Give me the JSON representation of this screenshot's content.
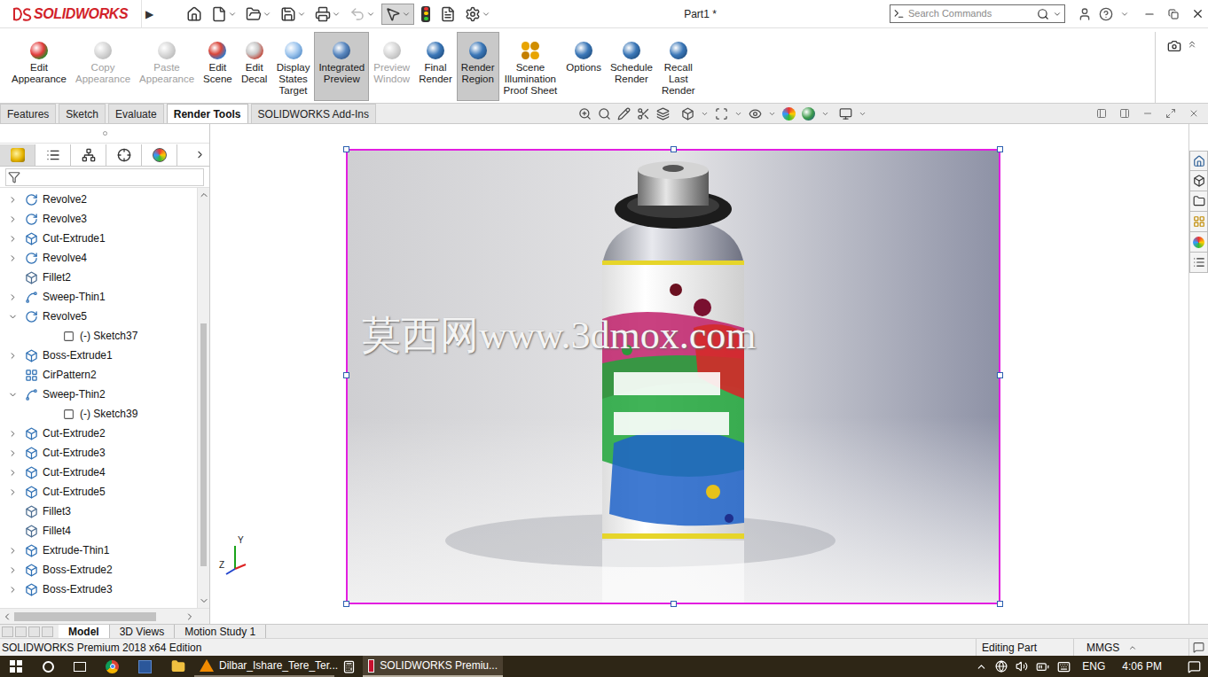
{
  "title_bar": {
    "logo": "SOLIDWORKS",
    "expand": "▶",
    "document": "Part1 *",
    "search": {
      "placeholder": "Search Commands"
    }
  },
  "quick_access": [
    {
      "kind": "home",
      "disabled": false,
      "selected": false
    },
    {
      "kind": "new",
      "disabled": false,
      "selected": false
    },
    {
      "kind": "open",
      "disabled": false,
      "selected": false
    },
    {
      "kind": "save",
      "disabled": false,
      "selected": false
    },
    {
      "kind": "print",
      "disabled": false,
      "selected": false
    },
    {
      "kind": "undo",
      "disabled": true,
      "selected": false
    },
    {
      "kind": "select",
      "disabled": false,
      "selected": true
    },
    {
      "kind": "rebuild",
      "disabled": false,
      "selected": false
    },
    {
      "kind": "properties",
      "disabled": false,
      "selected": false
    },
    {
      "kind": "options",
      "disabled": false,
      "selected": false
    }
  ],
  "ribbon": [
    {
      "kind": "appearance",
      "label": [
        "Edit",
        "Appearance"
      ],
      "disabled": false,
      "selected": false
    },
    {
      "kind": "copy",
      "label": [
        "Copy",
        "Appearance"
      ],
      "disabled": true,
      "selected": false
    },
    {
      "kind": "paste",
      "label": [
        "Paste",
        "Appearance"
      ],
      "disabled": true,
      "selected": false
    },
    {
      "kind": "scene",
      "label": [
        "Edit",
        "Scene"
      ],
      "disabled": false,
      "selected": false
    },
    {
      "kind": "decal",
      "label": [
        "Edit",
        "Decal"
      ],
      "disabled": false,
      "selected": false
    },
    {
      "kind": "display-states",
      "label": [
        "Display",
        "States",
        "Target"
      ],
      "disabled": false,
      "selected": false
    },
    {
      "kind": "integrated-preview",
      "label": [
        "Integrated",
        "Preview"
      ],
      "disabled": false,
      "selected": true
    },
    {
      "kind": "preview-window",
      "label": [
        "Preview",
        "Window"
      ],
      "disabled": true,
      "selected": false
    },
    {
      "kind": "final-render",
      "label": [
        "Final",
        "Render"
      ],
      "disabled": false,
      "selected": false
    },
    {
      "kind": "render-region",
      "label": [
        "Render",
        "Region"
      ],
      "disabled": false,
      "selected": true
    },
    {
      "kind": "illumination",
      "label": [
        "Scene",
        "Illumination",
        "Proof Sheet"
      ],
      "disabled": false,
      "selected": false
    },
    {
      "kind": "options",
      "label": [
        "Options"
      ],
      "disabled": false,
      "selected": false
    },
    {
      "kind": "schedule",
      "label": [
        "Schedule",
        "Render"
      ],
      "disabled": false,
      "selected": false
    },
    {
      "kind": "recall",
      "label": [
        "Recall",
        "Last",
        "Render"
      ],
      "disabled": false,
      "selected": false
    }
  ],
  "command_tabs": [
    {
      "label": "Features",
      "selected": false
    },
    {
      "label": "Sketch",
      "selected": false
    },
    {
      "label": "Evaluate",
      "selected": false
    },
    {
      "label": "Render Tools",
      "selected": true
    },
    {
      "label": "SOLIDWORKS Add-Ins",
      "selected": false
    }
  ],
  "panel_tabs": [
    {
      "kind": "features",
      "selected": true
    },
    {
      "kind": "properties",
      "selected": false
    },
    {
      "kind": "configurations",
      "selected": false
    },
    {
      "kind": "dimxpert",
      "selected": false
    },
    {
      "kind": "display",
      "selected": false
    }
  ],
  "tree": [
    {
      "label": "Revolve2",
      "kind": "revolve",
      "depth": 0,
      "expandable": true,
      "expanded": false
    },
    {
      "label": "Revolve3",
      "kind": "revolve",
      "depth": 0,
      "expandable": true,
      "expanded": false
    },
    {
      "label": "Cut-Extrude1",
      "kind": "cut",
      "depth": 0,
      "expandable": true,
      "expanded": false
    },
    {
      "label": "Revolve4",
      "kind": "revolve",
      "depth": 0,
      "expandable": true,
      "expanded": false
    },
    {
      "label": "Fillet2",
      "kind": "fillet",
      "depth": 0,
      "expandable": false,
      "expanded": false
    },
    {
      "label": "Sweep-Thin1",
      "kind": "sweep",
      "depth": 0,
      "expandable": true,
      "expanded": false
    },
    {
      "label": "Revolve5",
      "kind": "revolve",
      "depth": 0,
      "expandable": true,
      "expanded": true
    },
    {
      "label": "(-) Sketch37",
      "kind": "sketch",
      "depth": 1,
      "expandable": false,
      "expanded": false
    },
    {
      "label": "Boss-Extrude1",
      "kind": "boss",
      "depth": 0,
      "expandable": true,
      "expanded": false
    },
    {
      "label": "CirPattern2",
      "kind": "pattern",
      "depth": 0,
      "expandable": false,
      "expanded": false
    },
    {
      "label": "Sweep-Thin2",
      "kind": "sweep",
      "depth": 0,
      "expandable": true,
      "expanded": true
    },
    {
      "label": "(-) Sketch39",
      "kind": "sketch",
      "depth": 1,
      "expandable": false,
      "expanded": false
    },
    {
      "label": "Cut-Extrude2",
      "kind": "cut",
      "depth": 0,
      "expandable": true,
      "expanded": false
    },
    {
      "label": "Cut-Extrude3",
      "kind": "cut",
      "depth": 0,
      "expandable": true,
      "expanded": false
    },
    {
      "label": "Cut-Extrude4",
      "kind": "cut",
      "depth": 0,
      "expandable": true,
      "expanded": false
    },
    {
      "label": "Cut-Extrude5",
      "kind": "cut",
      "depth": 0,
      "expandable": true,
      "expanded": false
    },
    {
      "label": "Fillet3",
      "kind": "fillet",
      "depth": 0,
      "expandable": false,
      "expanded": false
    },
    {
      "label": "Fillet4",
      "kind": "fillet",
      "depth": 0,
      "expandable": false,
      "expanded": false
    },
    {
      "label": "Extrude-Thin1",
      "kind": "boss",
      "depth": 0,
      "expandable": true,
      "expanded": false
    },
    {
      "label": "Boss-Extrude2",
      "kind": "boss",
      "depth": 0,
      "expandable": true,
      "expanded": false
    },
    {
      "label": "Boss-Extrude3",
      "kind": "boss",
      "depth": 0,
      "expandable": true,
      "expanded": false
    }
  ],
  "tree_scrollbar": {
    "thumb_start": 0.31,
    "thumb_size": 0.62
  },
  "tree_hscrollbar": {
    "thumb_start": 0.0,
    "thumb_size": 0.84
  },
  "render": {
    "watermark": "莫西网www.3dmox.com"
  },
  "triad": {
    "y": "Y",
    "z": "Z"
  },
  "bottom_tabs": [
    {
      "label": "Model",
      "selected": true
    },
    {
      "label": "3D Views",
      "selected": false
    },
    {
      "label": "Motion Study 1",
      "selected": false
    }
  ],
  "status_bar": {
    "edition": "SOLIDWORKS Premium 2018 x64 Edition",
    "mode": "Editing Part",
    "units": "MMGS"
  },
  "taskbar": {
    "windows": [
      {
        "kind": "media",
        "label": "Dilbar_Ishare_Tere_Ter...",
        "active": false
      },
      {
        "kind": "solidworks",
        "label": "SOLIDWORKS Premiu...",
        "active": true
      }
    ],
    "language": "ENG",
    "time": "4:06 PM"
  }
}
